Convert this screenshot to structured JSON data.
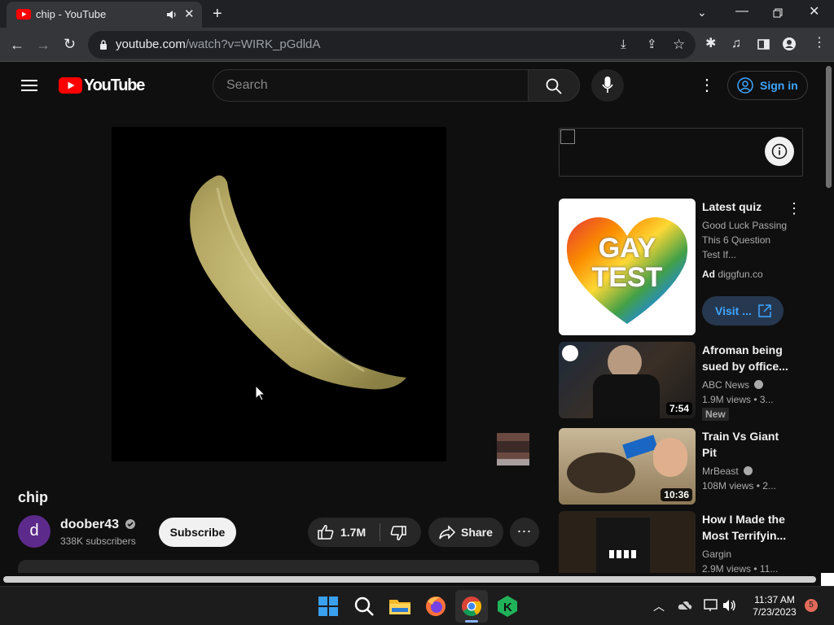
{
  "browser": {
    "tab_title": "chip - YouTube",
    "url_host": "youtube.com",
    "url_path": "/watch?v=WIRK_pGdldA"
  },
  "header": {
    "logo_text": "YouTube",
    "search_placeholder": "Search",
    "signin_label": "Sign in"
  },
  "video": {
    "title": "chip",
    "channel": "doober43",
    "avatar_letter": "d",
    "subscribers": "338K subscribers",
    "subscribe_label": "Subscribe",
    "likes": "1.7M",
    "share_label": "Share"
  },
  "ad": {
    "thumb_line1": "GAY",
    "thumb_line2": "TEST",
    "title": "Latest quiz",
    "description": "Good Luck Passing This 6 Question Test If...",
    "ad_label": "Ad",
    "domain": "diggfun.co",
    "visit_label": "Visit ..."
  },
  "recommendations": [
    {
      "title": "Afroman being sued by office...",
      "channel": "ABC News",
      "meta": "1.9M views  • 3...",
      "duration": "7:54",
      "badge": "New"
    },
    {
      "title": "Train Vs Giant Pit",
      "channel": "MrBeast",
      "meta": "108M views  • 2...",
      "duration": "10:36"
    },
    {
      "title": "How I Made the Most Terrifyin...",
      "channel": "Gargin",
      "meta": "2.9M views  • 11..."
    }
  ],
  "taskbar": {
    "time": "11:37 AM",
    "date": "7/23/2023",
    "notification_count": "5"
  },
  "colors": {
    "youtube_red": "#ff0000",
    "link_blue": "#3ea6ff",
    "background": "#0f0f0f"
  }
}
